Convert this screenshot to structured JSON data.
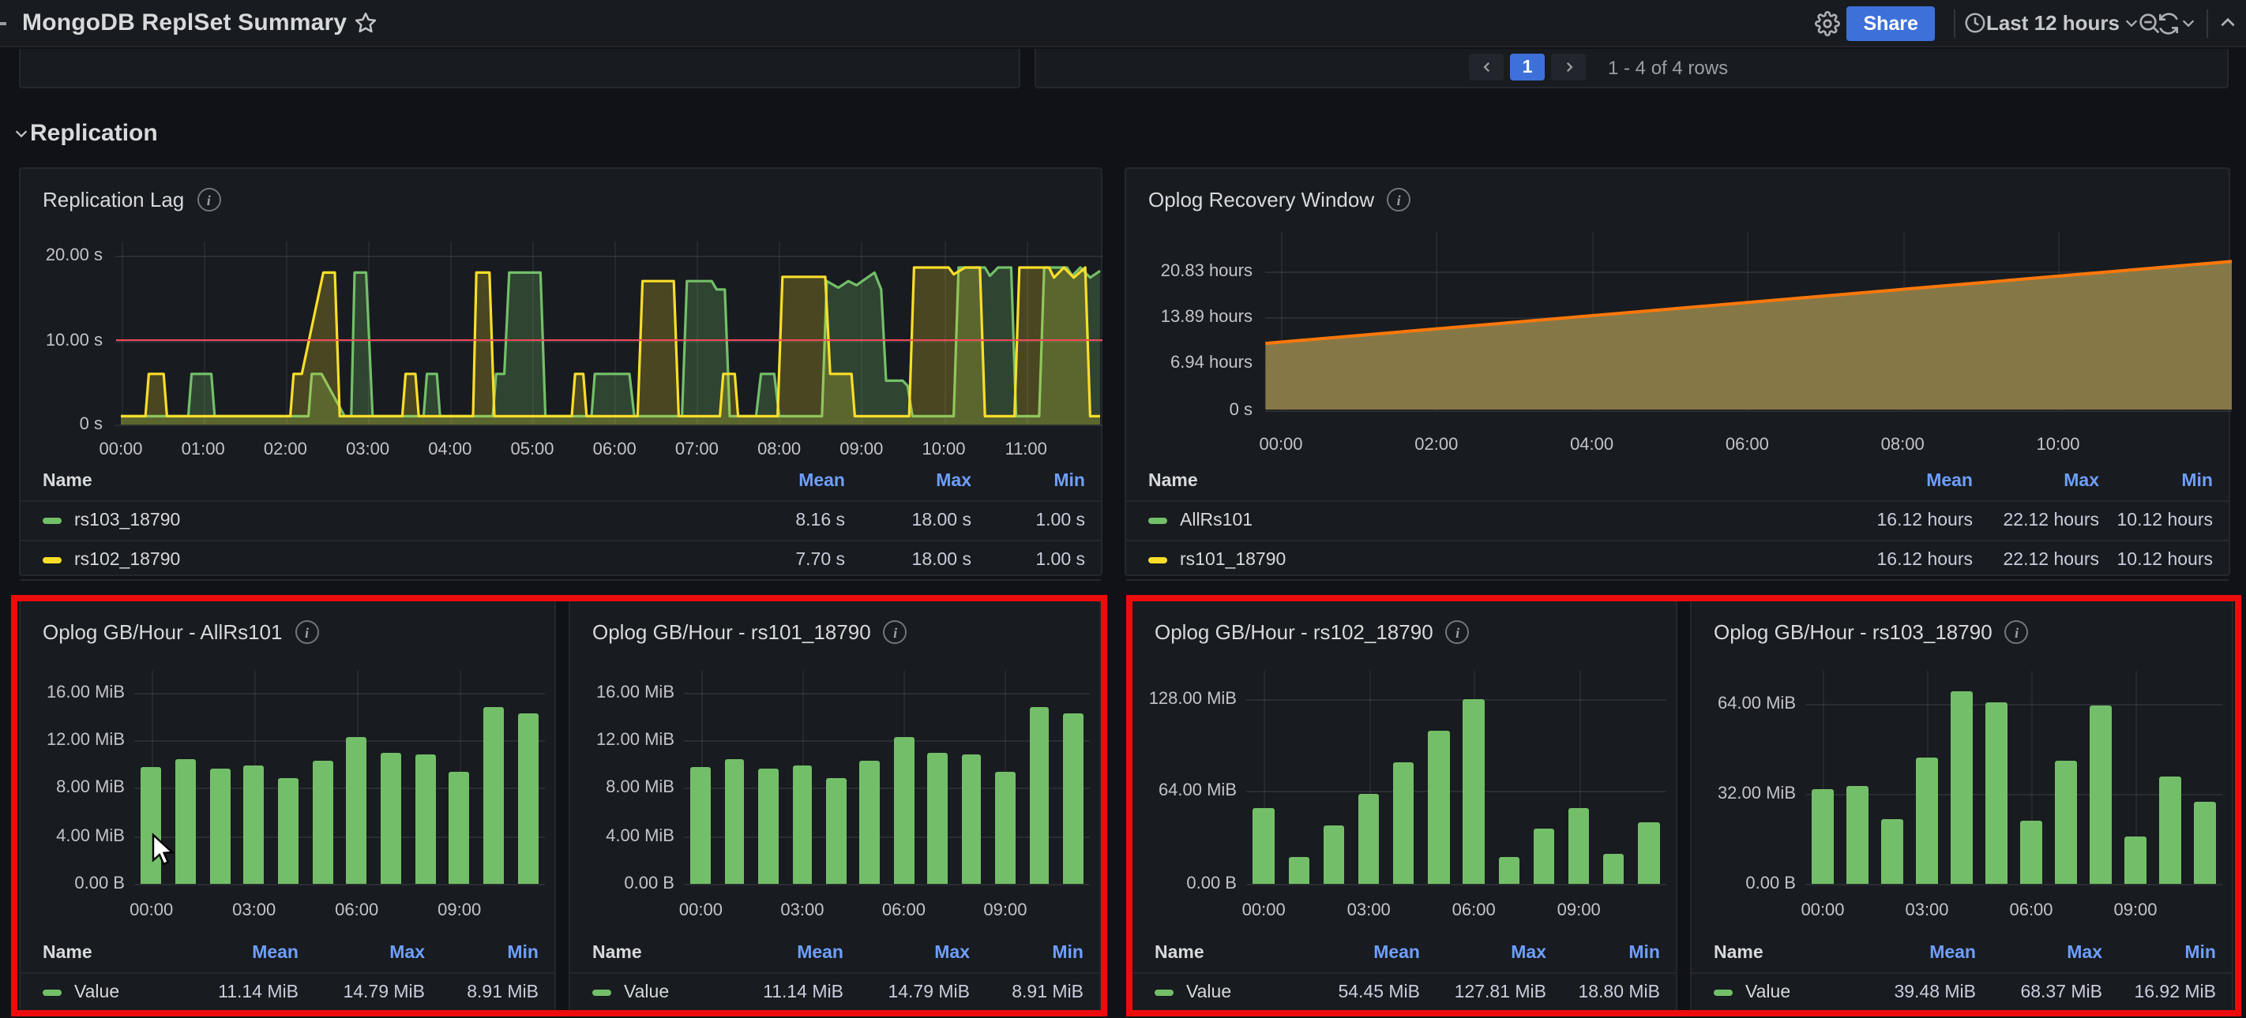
{
  "navbar": {
    "title": "MongoDB ReplSet Summary",
    "share_label": "Share",
    "time_range": "Last 12 hours"
  },
  "pagination": {
    "current_page": "1",
    "summary": "1 - 4 of 4 rows"
  },
  "section": {
    "title": "Replication"
  },
  "colors": {
    "green": "#73BF69",
    "yellow": "#FADE2A",
    "orange": "#FF780A",
    "threshold_red": "#F2495C",
    "accent_blue": "#3D71D9",
    "link_blue": "#6E9FFF",
    "highlight_red": "#EE0B0B"
  },
  "panels": {
    "replication_lag": {
      "title": "Replication Lag",
      "legend_headers": [
        "Name",
        "Mean",
        "Max",
        "Min"
      ],
      "legend_rows": [
        {
          "name": "rs103_18790",
          "color": "#73BF69",
          "mean": "8.16 s",
          "max": "18.00 s",
          "min": "1.00 s"
        },
        {
          "name": "rs102_18790",
          "color": "#FADE2A",
          "mean": "7.70 s",
          "max": "18.00 s",
          "min": "1.00 s"
        }
      ],
      "chart_data": {
        "type": "line",
        "x_domain_hours": [
          0,
          11.9
        ],
        "xticks": [
          "00:00",
          "01:00",
          "02:00",
          "03:00",
          "04:00",
          "05:00",
          "06:00",
          "07:00",
          "08:00",
          "09:00",
          "10:00",
          "11:00"
        ],
        "yticks": [
          {
            "v": 0,
            "label": "0 s"
          },
          {
            "v": 10,
            "label": "10.00 s"
          },
          {
            "v": 20,
            "label": "20.00 s"
          }
        ],
        "threshold_s": 10,
        "series": [
          {
            "name": "rs103_18790",
            "color": "#73BF69",
            "fill_opacity": 0.25,
            "points": [
              [
                0,
                1
              ],
              [
                0.82,
                1
              ],
              [
                0.86,
                6
              ],
              [
                1.1,
                6
              ],
              [
                1.14,
                1
              ],
              [
                2.28,
                1
              ],
              [
                2.32,
                6
              ],
              [
                2.44,
                6
              ],
              [
                2.72,
                1
              ],
              [
                2.8,
                1
              ],
              [
                2.84,
                18
              ],
              [
                2.98,
                18
              ],
              [
                3.06,
                1
              ],
              [
                3.68,
                1
              ],
              [
                3.72,
                6
              ],
              [
                3.84,
                6
              ],
              [
                3.88,
                1
              ],
              [
                4.52,
                1
              ],
              [
                4.56,
                6
              ],
              [
                4.66,
                6
              ],
              [
                4.72,
                18
              ],
              [
                5.1,
                18
              ],
              [
                5.16,
                1
              ],
              [
                5.72,
                1
              ],
              [
                5.76,
                6
              ],
              [
                6.18,
                6
              ],
              [
                6.24,
                1
              ],
              [
                6.82,
                1
              ],
              [
                6.88,
                17
              ],
              [
                7.18,
                17
              ],
              [
                7.24,
                16
              ],
              [
                7.34,
                16
              ],
              [
                7.4,
                1
              ],
              [
                7.72,
                1
              ],
              [
                7.78,
                6
              ],
              [
                7.94,
                6
              ],
              [
                8.0,
                1
              ],
              [
                8.52,
                1
              ],
              [
                8.58,
                17
              ],
              [
                8.72,
                16.2
              ],
              [
                8.84,
                17
              ],
              [
                8.94,
                16.5
              ],
              [
                9.04,
                17.2
              ],
              [
                9.16,
                18
              ],
              [
                9.24,
                16
              ],
              [
                9.3,
                5.2
              ],
              [
                9.5,
                5.2
              ],
              [
                9.56,
                4.6
              ],
              [
                9.62,
                1
              ],
              [
                10.12,
                1
              ],
              [
                10.18,
                18.6
              ],
              [
                10.5,
                18.6
              ],
              [
                10.56,
                17.6
              ],
              [
                10.66,
                18.6
              ],
              [
                10.82,
                18.6
              ],
              [
                10.88,
                1
              ],
              [
                11.16,
                1
              ],
              [
                11.22,
                18.6
              ],
              [
                11.5,
                18.6
              ],
              [
                11.56,
                17.6
              ],
              [
                11.66,
                18.6
              ],
              [
                11.78,
                17.4
              ],
              [
                11.9,
                18.2
              ]
            ]
          },
          {
            "name": "rs102_18790",
            "color": "#FADE2A",
            "fill_opacity": 0.22,
            "points": [
              [
                0,
                1
              ],
              [
                0.3,
                1
              ],
              [
                0.34,
                6
              ],
              [
                0.52,
                6
              ],
              [
                0.56,
                1
              ],
              [
                2.06,
                1
              ],
              [
                2.1,
                6
              ],
              [
                2.2,
                6
              ],
              [
                2.46,
                18
              ],
              [
                2.6,
                18
              ],
              [
                2.66,
                1
              ],
              [
                3.42,
                1
              ],
              [
                3.46,
                6
              ],
              [
                3.58,
                6
              ],
              [
                3.62,
                1
              ],
              [
                4.28,
                1
              ],
              [
                4.32,
                18
              ],
              [
                4.48,
                18
              ],
              [
                4.54,
                1
              ],
              [
                5.48,
                1
              ],
              [
                5.52,
                6
              ],
              [
                5.62,
                6
              ],
              [
                5.66,
                1
              ],
              [
                6.28,
                1
              ],
              [
                6.34,
                17
              ],
              [
                6.72,
                17
              ],
              [
                6.78,
                1
              ],
              [
                7.28,
                1
              ],
              [
                7.32,
                6
              ],
              [
                7.46,
                6
              ],
              [
                7.5,
                1
              ],
              [
                7.98,
                1
              ],
              [
                8.04,
                17.5
              ],
              [
                8.56,
                17.5
              ],
              [
                8.62,
                6
              ],
              [
                8.88,
                6
              ],
              [
                8.92,
                1
              ],
              [
                9.58,
                1
              ],
              [
                9.64,
                18.6
              ],
              [
                10.06,
                18.6
              ],
              [
                10.12,
                17.8
              ],
              [
                10.26,
                18.6
              ],
              [
                10.44,
                18.6
              ],
              [
                10.5,
                1
              ],
              [
                10.86,
                1
              ],
              [
                10.92,
                18.6
              ],
              [
                11.28,
                18.6
              ],
              [
                11.34,
                17.4
              ],
              [
                11.46,
                18.6
              ],
              [
                11.58,
                17.4
              ],
              [
                11.72,
                18.6
              ],
              [
                11.78,
                1
              ],
              [
                11.9,
                1
              ]
            ]
          }
        ]
      }
    },
    "oplog_recovery": {
      "title": "Oplog Recovery Window",
      "legend_headers": [
        "Name",
        "Mean",
        "Max",
        "Min"
      ],
      "legend_rows": [
        {
          "name": "AllRs101",
          "color": "#73BF69",
          "mean": "16.12 hours",
          "max": "22.12 hours",
          "min": "10.12 hours"
        },
        {
          "name": "rs101_18790",
          "color": "#FADE2A",
          "mean": "16.12 hours",
          "max": "22.12 hours",
          "min": "10.12 hours"
        }
      ],
      "chart_data": {
        "type": "area",
        "x_domain_hours": [
          -0.2,
          12.24
        ],
        "xticks": [
          {
            "t": 0,
            "label": "00:00"
          },
          {
            "t": 2,
            "label": "02:00"
          },
          {
            "t": 4,
            "label": "04:00"
          },
          {
            "t": 6,
            "label": "06:00"
          },
          {
            "t": 8,
            "label": "08:00"
          },
          {
            "t": 10,
            "label": "10:00"
          }
        ],
        "yticks": [
          {
            "v": 0,
            "label": "0 s"
          },
          {
            "v": 6.94,
            "label": "6.94 hours"
          },
          {
            "v": 13.89,
            "label": "13.89 hours"
          },
          {
            "v": 20.83,
            "label": "20.83 hours"
          }
        ],
        "line_color": "#FF780A",
        "fill_color": "#8a7c48",
        "points": [
          [
            -0.2,
            10.04
          ],
          [
            12.24,
            22.46
          ]
        ]
      }
    },
    "oplog": [
      {
        "title": "Oplog GB/Hour - AllRs101",
        "legend_headers": [
          "Name",
          "Mean",
          "Max",
          "Min"
        ],
        "legend_rows": [
          {
            "name": "Value",
            "color": "#73BF69",
            "mean": "11.14 MiB",
            "max": "14.79 MiB",
            "min": "8.91 MiB"
          }
        ],
        "chart_data": {
          "type": "bar",
          "unit": "MiB",
          "ylim": 17.0,
          "yticks": [
            {
              "v": 0,
              "label": "0.00 B"
            },
            {
              "v": 4,
              "label": "4.00 MiB"
            },
            {
              "v": 8,
              "label": "8.00 MiB"
            },
            {
              "v": 12,
              "label": "12.00 MiB"
            },
            {
              "v": 16,
              "label": "16.00 MiB"
            }
          ],
          "xticks": [
            {
              "i": 0,
              "label": "00:00"
            },
            {
              "i": 3,
              "label": "03:00"
            },
            {
              "i": 6,
              "label": "06:00"
            },
            {
              "i": 9,
              "label": "09:00"
            }
          ],
          "values": [
            9.8,
            10.4,
            9.6,
            9.9,
            8.9,
            10.3,
            12.2,
            11.0,
            10.85,
            9.3,
            14.79,
            14.2
          ]
        }
      },
      {
        "title": "Oplog GB/Hour - rs101_18790",
        "legend_headers": [
          "Name",
          "Mean",
          "Max",
          "Min"
        ],
        "legend_rows": [
          {
            "name": "Value",
            "color": "#73BF69",
            "mean": "11.14 MiB",
            "max": "14.79 MiB",
            "min": "8.91 MiB"
          }
        ],
        "chart_data": {
          "type": "bar",
          "unit": "MiB",
          "ylim": 17.0,
          "yticks": [
            {
              "v": 0,
              "label": "0.00 B"
            },
            {
              "v": 4,
              "label": "4.00 MiB"
            },
            {
              "v": 8,
              "label": "8.00 MiB"
            },
            {
              "v": 12,
              "label": "12.00 MiB"
            },
            {
              "v": 16,
              "label": "16.00 MiB"
            }
          ],
          "xticks": [
            {
              "i": 0,
              "label": "00:00"
            },
            {
              "i": 3,
              "label": "03:00"
            },
            {
              "i": 6,
              "label": "06:00"
            },
            {
              "i": 9,
              "label": "09:00"
            }
          ],
          "values": [
            9.8,
            10.4,
            9.6,
            9.9,
            8.9,
            10.3,
            12.2,
            11.0,
            10.85,
            9.3,
            14.79,
            14.2
          ]
        }
      },
      {
        "title": "Oplog GB/Hour - rs102_18790",
        "legend_headers": [
          "Name",
          "Mean",
          "Max",
          "Min"
        ],
        "legend_rows": [
          {
            "name": "Value",
            "color": "#73BF69",
            "mean": "54.45 MiB",
            "max": "127.81 MiB",
            "min": "18.80 MiB"
          }
        ],
        "chart_data": {
          "type": "bar",
          "unit": "MiB",
          "ylim": 141,
          "yticks": [
            {
              "v": 0,
              "label": "0.00 B"
            },
            {
              "v": 64,
              "label": "64.00 MiB"
            },
            {
              "v": 128,
              "label": "128.00 MiB"
            }
          ],
          "xticks": [
            {
              "i": 0,
              "label": "00:00"
            },
            {
              "i": 3,
              "label": "03:00"
            },
            {
              "i": 6,
              "label": "06:00"
            },
            {
              "i": 9,
              "label": "09:00"
            }
          ],
          "values": [
            52,
            18.8,
            40,
            62,
            84,
            106,
            127.81,
            19,
            38,
            52,
            21,
            43
          ]
        }
      },
      {
        "title": "Oplog GB/Hour - rs103_18790",
        "legend_headers": [
          "Name",
          "Mean",
          "Max",
          "Min"
        ],
        "legend_rows": [
          {
            "name": "Value",
            "color": "#73BF69",
            "mean": "39.48 MiB",
            "max": "68.37 MiB",
            "min": "16.92 MiB"
          }
        ],
        "chart_data": {
          "type": "bar",
          "unit": "MiB",
          "ylim": 72.5,
          "yticks": [
            {
              "v": 0,
              "label": "0.00 B"
            },
            {
              "v": 32,
              "label": "32.00 MiB"
            },
            {
              "v": 64,
              "label": "64.00 MiB"
            }
          ],
          "xticks": [
            {
              "i": 0,
              "label": "00:00"
            },
            {
              "i": 3,
              "label": "03:00"
            },
            {
              "i": 6,
              "label": "06:00"
            },
            {
              "i": 9,
              "label": "09:00"
            }
          ],
          "values": [
            34,
            35,
            23,
            45,
            68.37,
            64.5,
            22.5,
            44,
            63.5,
            16.92,
            38,
            29
          ]
        }
      }
    ]
  }
}
